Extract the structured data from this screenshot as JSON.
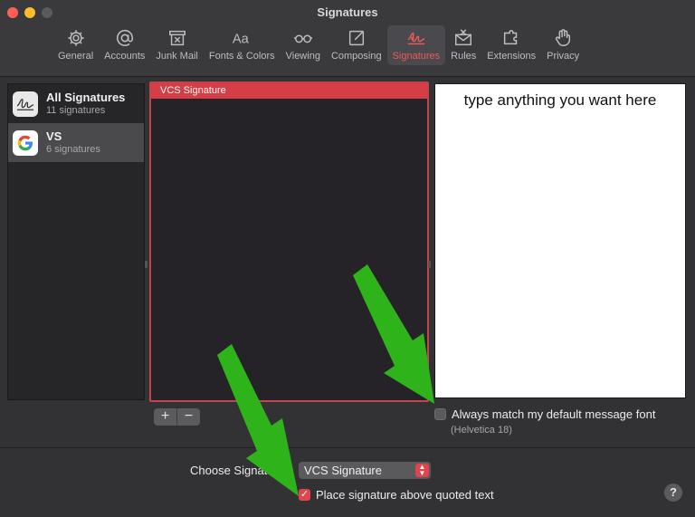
{
  "window": {
    "title": "Signatures"
  },
  "toolbar": {
    "items": [
      {
        "label": "General",
        "icon": "gear-icon"
      },
      {
        "label": "Accounts",
        "icon": "at-icon"
      },
      {
        "label": "Junk Mail",
        "icon": "junk-mail-icon"
      },
      {
        "label": "Fonts & Colors",
        "icon": "fonts-icon"
      },
      {
        "label": "Viewing",
        "icon": "glasses-icon"
      },
      {
        "label": "Composing",
        "icon": "compose-icon"
      },
      {
        "label": "Signatures",
        "icon": "signature-icon",
        "active": true
      },
      {
        "label": "Rules",
        "icon": "rules-icon"
      },
      {
        "label": "Extensions",
        "icon": "extensions-icon"
      },
      {
        "label": "Privacy",
        "icon": "hand-icon"
      }
    ]
  },
  "accounts": [
    {
      "name": "All Signatures",
      "count": "11 signatures",
      "icon": "signature-icon"
    },
    {
      "name": "VS",
      "count": "6 signatures",
      "icon": "google-icon",
      "selected": true
    }
  ],
  "signatures": {
    "items": [
      {
        "name": "VCS Signature",
        "selected": true
      }
    ]
  },
  "editor": {
    "text": "type anything you want here"
  },
  "buttons": {
    "add": "+",
    "remove": "−",
    "help": "?"
  },
  "match_font": {
    "label": "Always match my default message font",
    "font": "(Helvetica 18)",
    "checked": false
  },
  "choose": {
    "label": "Choose Signature:",
    "value": "VCS Signature"
  },
  "place_above": {
    "label": "Place signature above quoted text",
    "checked": true
  },
  "colors": {
    "accent": "#d63d47",
    "annotation_arrow": "#2fb31a"
  }
}
